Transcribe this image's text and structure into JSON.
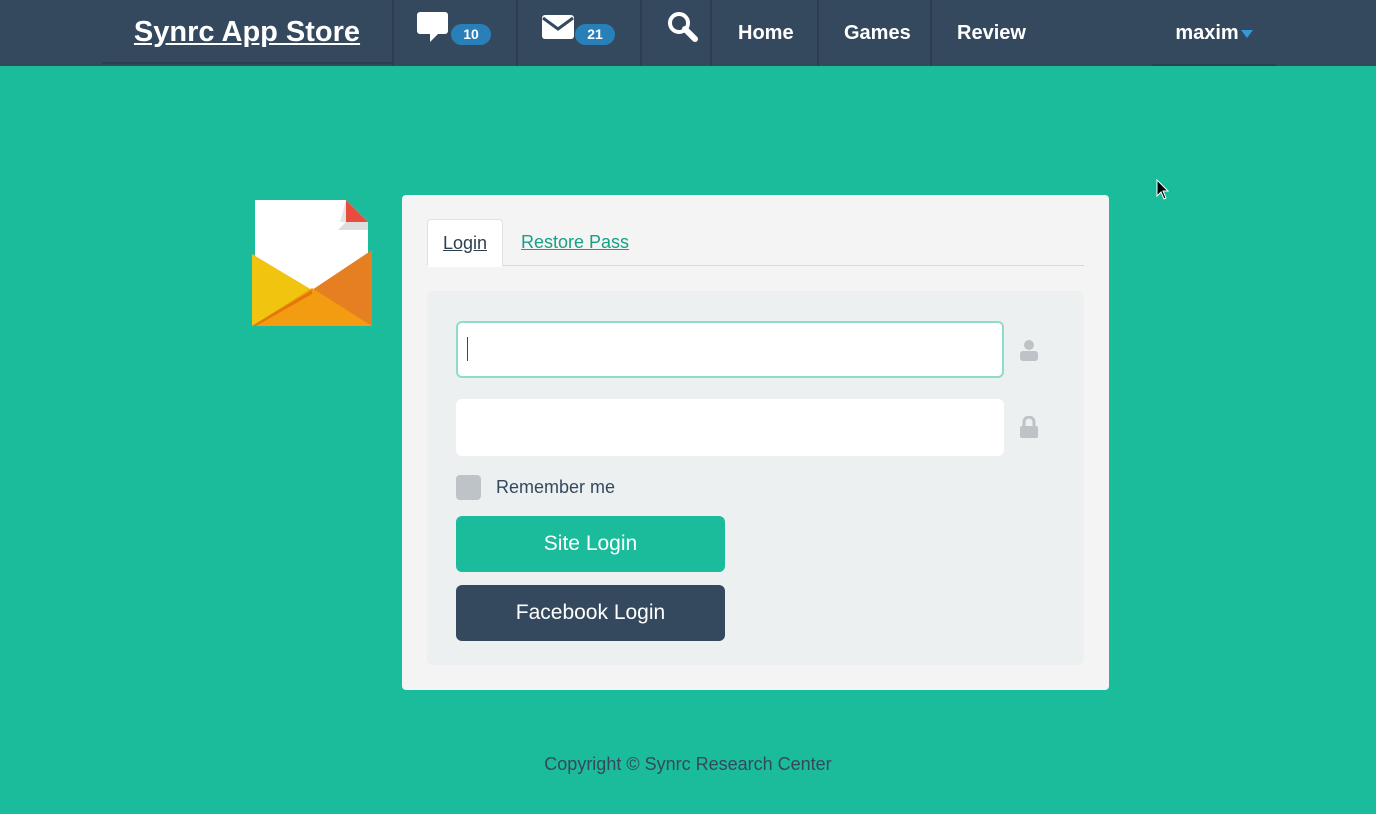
{
  "nav": {
    "brand": "Synrc App Store",
    "comments_count": "10",
    "messages_count": "21",
    "links": [
      "Home",
      "Games",
      "Review"
    ],
    "user": "maxim"
  },
  "tabs": [
    {
      "label": "Login",
      "active": true
    },
    {
      "label": "Restore Pass",
      "active": false
    }
  ],
  "form": {
    "username_value": "",
    "password_value": "",
    "remember_label": "Remember me",
    "remember_checked": false,
    "site_login": "Site Login",
    "facebook_login": "Facebook Login"
  },
  "footer": "Copyright © Synrc Research Center",
  "colors": {
    "accent": "#1abc9c",
    "navbar": "#34495e",
    "badge": "#2980b9",
    "link": "#16a085"
  }
}
